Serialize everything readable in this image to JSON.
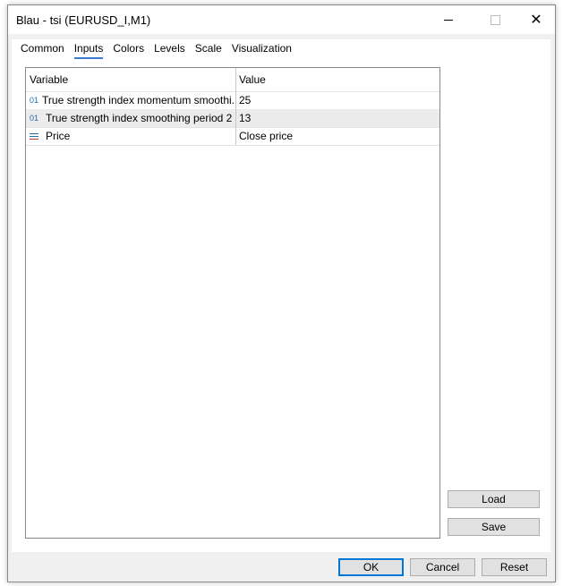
{
  "window": {
    "title": "Blau - tsi (EURUSD_I,M1)"
  },
  "tabs": [
    {
      "label": "Common"
    },
    {
      "label": "Inputs",
      "active": true
    },
    {
      "label": "Colors"
    },
    {
      "label": "Levels"
    },
    {
      "label": "Scale"
    },
    {
      "label": "Visualization"
    }
  ],
  "table": {
    "headers": [
      "Variable",
      "Value"
    ],
    "rows": [
      {
        "icon": "integer-icon",
        "icon_text": "01",
        "variable": "True strength index momentum smoothi...",
        "value": "25"
      },
      {
        "icon": "integer-icon",
        "icon_text": "01",
        "variable": "True strength index smoothing period 2",
        "value": "13"
      },
      {
        "icon": "enum-list-icon",
        "icon_text": "",
        "variable": "Price",
        "value": "Close price"
      }
    ]
  },
  "buttons": {
    "load": "Load",
    "save": "Save",
    "ok": "OK",
    "cancel": "Cancel",
    "reset": "Reset"
  }
}
